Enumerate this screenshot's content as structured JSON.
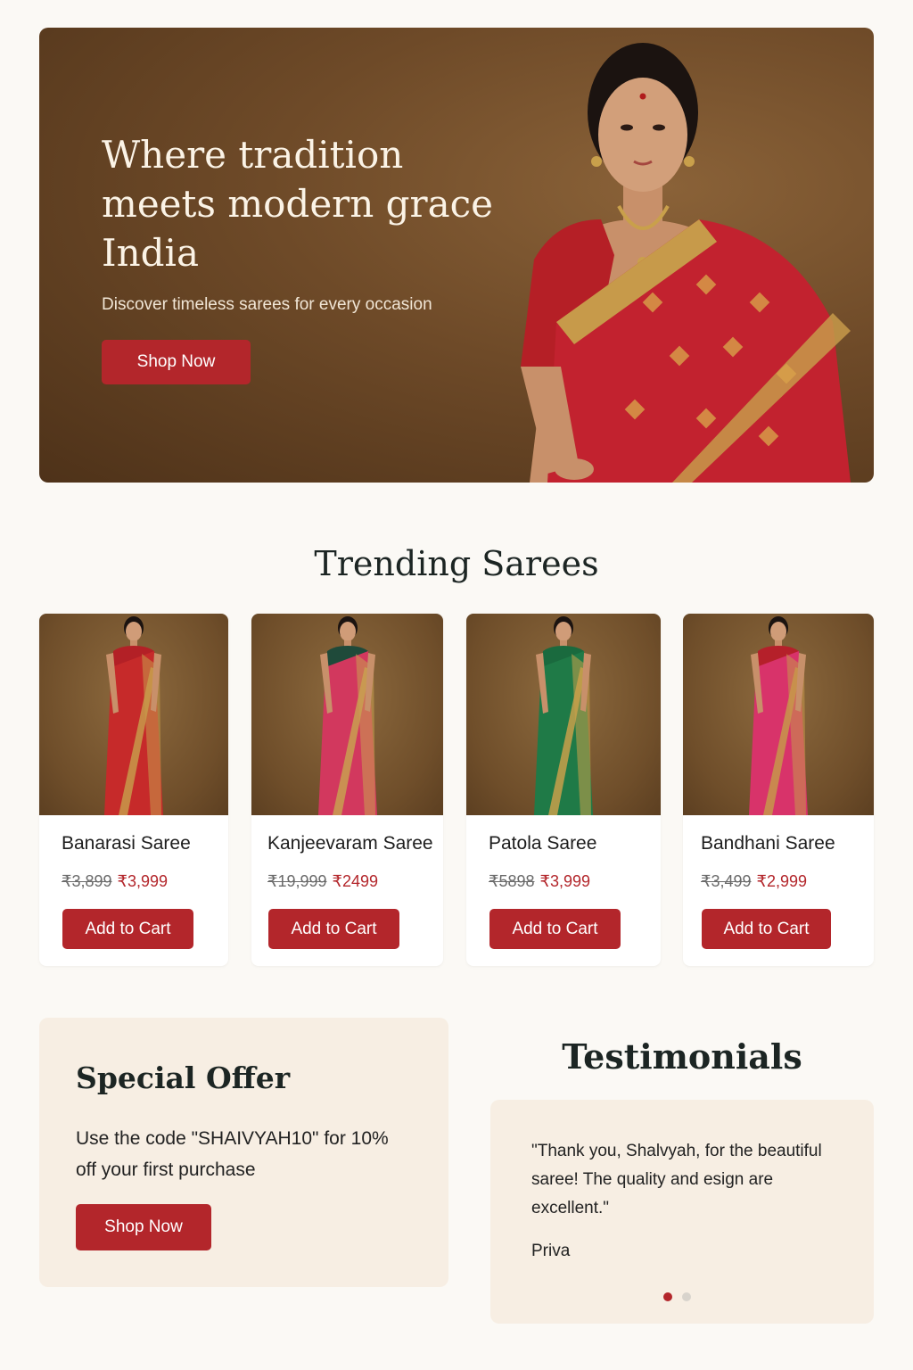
{
  "hero": {
    "title": "Where tradition\nmeets modern grace\nIndia",
    "subtitle": "Discover timeless sarees for every occasion",
    "cta_label": "Shop Now"
  },
  "trending": {
    "title": "Trending Sarees",
    "products": [
      {
        "name": "Banarasi Saree",
        "old_price": "₹3,899",
        "price": "₹3,999",
        "cta": "Add to Cart",
        "saree_color": "#c62a2a",
        "border_color": "#c79a4a",
        "blouse_color": "#b32026"
      },
      {
        "name": "Kanjeevaram Saree",
        "old_price": "₹19,999",
        "price": "₹2499",
        "cta": "Add to Cart",
        "saree_color": "#d2385e",
        "border_color": "#c9a050",
        "blouse_color": "#1f4a3a"
      },
      {
        "name": "Patola Saree",
        "old_price": "₹5898",
        "price": "₹3,999",
        "cta": "Add to Cart",
        "saree_color": "#1f7a47",
        "border_color": "#c9a04b",
        "blouse_color": "#1a6a3e"
      },
      {
        "name": "Bandhani Saree",
        "old_price": "₹3,499",
        "price": "₹2,999",
        "cta": "Add to Cart",
        "saree_color": "#d8336a",
        "border_color": "#c7984a",
        "blouse_color": "#b5202a"
      }
    ]
  },
  "offer": {
    "title": "Special Offer",
    "text": "Use the code \"SHAIVYAH10\" for 10% off your first purchase",
    "cta_label": "Shop Now"
  },
  "testimonials": {
    "title": "Testimonials",
    "quote": "\"Thank you, Shalvyah, for the beautiful saree! The quality and esign are excellent.\"",
    "author": "Priva",
    "active_index": 0,
    "total": 2
  },
  "colors": {
    "accent": "#b3262b",
    "background": "#fbf9f5",
    "panel": "#f7eee3",
    "hero_bg": "#6e4a28"
  }
}
